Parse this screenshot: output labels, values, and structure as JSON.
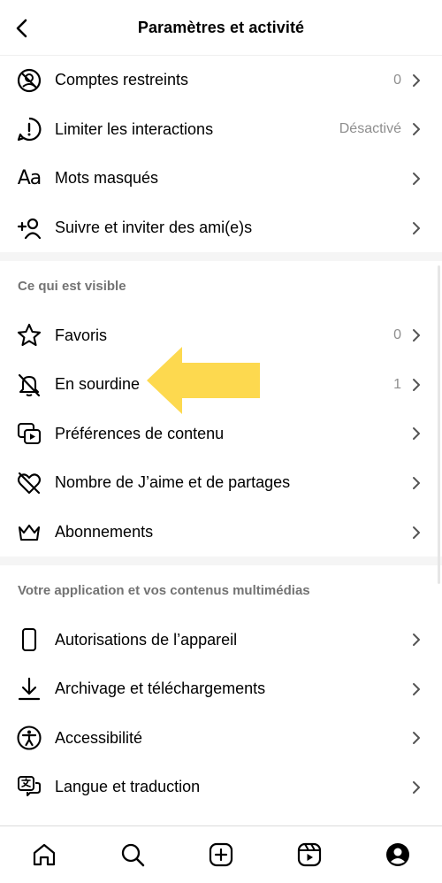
{
  "header": {
    "title": "Paramètres et activité",
    "back_icon": "chevron-left-icon"
  },
  "section1": {
    "items": [
      {
        "label": "Comptes restreints",
        "value": "0",
        "icon": "restricted-account-icon"
      },
      {
        "label": "Limiter les interactions",
        "value": "Désactivé",
        "icon": "alert-circle-icon"
      },
      {
        "label": "Mots masqués",
        "value": "",
        "icon": "text-aa-icon",
        "icon_text": "Aa"
      },
      {
        "label": "Suivre et inviter des ami(e)s",
        "value": "",
        "icon": "add-person-icon"
      }
    ]
  },
  "section2": {
    "title": "Ce qui est visible",
    "items": [
      {
        "label": "Favoris",
        "value": "0",
        "icon": "star-icon"
      },
      {
        "label": "En sourdine",
        "value": "1",
        "icon": "bell-muted-icon"
      },
      {
        "label": "Préférences de contenu",
        "value": "",
        "icon": "content-media-icon"
      },
      {
        "label": "Nombre de J’aime et de partages",
        "value": "",
        "icon": "heart-crossed-icon"
      },
      {
        "label": "Abonnements",
        "value": "",
        "icon": "crown-icon"
      }
    ]
  },
  "section3": {
    "title": "Votre application et vos contenus multimédias",
    "items": [
      {
        "label": "Autorisations de l’appareil",
        "value": "",
        "icon": "phone-icon"
      },
      {
        "label": "Archivage et téléchargements",
        "value": "",
        "icon": "download-icon"
      },
      {
        "label": "Accessibilité",
        "value": "",
        "icon": "accessibility-icon"
      },
      {
        "label": "Langue et traduction",
        "value": "",
        "icon": "translate-icon"
      }
    ]
  },
  "tabbar": {
    "items": [
      {
        "icon": "home-icon"
      },
      {
        "icon": "search-icon"
      },
      {
        "icon": "create-post-icon"
      },
      {
        "icon": "reels-icon"
      },
      {
        "icon": "profile-icon"
      }
    ]
  },
  "colors": {
    "annotation_arrow": "#fdd94f",
    "secondary_text": "#8e8e8e",
    "section_title": "#737373"
  }
}
